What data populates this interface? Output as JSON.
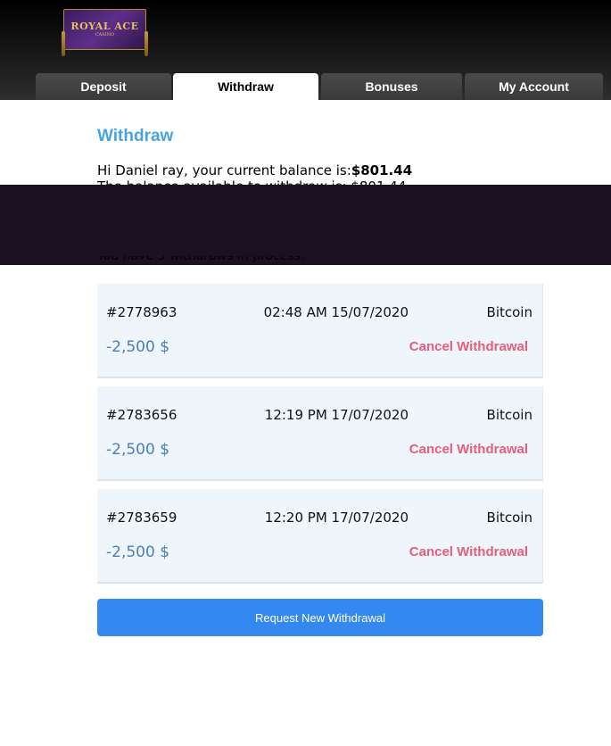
{
  "brand": {
    "logo_text": "ROYAL ACE",
    "logo_sub": "CASINO"
  },
  "tabs": [
    {
      "label": "Deposit",
      "active": false
    },
    {
      "label": "Withdraw",
      "active": true
    },
    {
      "label": "Bonuses",
      "active": false
    },
    {
      "label": "My Account",
      "active": false
    }
  ],
  "page": {
    "title": "Withdraw",
    "balance_prefix": "Hi Daniel ray, your current balance is:",
    "balance_value": "$801.44",
    "partial_line": "The balance available to withdraw is: $801.44",
    "partial_line2": "You have 3 withdraws in process:"
  },
  "withdrawals": [
    {
      "id": "#2778963",
      "datetime": "02:48 AM 15/07/2020",
      "method": "Bitcoin",
      "amount": "-2,500 $",
      "cancel_label": "Cancel Withdrawal"
    },
    {
      "id": "#2783656",
      "datetime": "12:19 PM 17/07/2020",
      "method": "Bitcoin",
      "amount": "-2,500 $",
      "cancel_label": "Cancel Withdrawal"
    },
    {
      "id": "#2783659",
      "datetime": "12:20 PM 17/07/2020",
      "method": "Bitcoin",
      "amount": "-2,500 $",
      "cancel_label": "Cancel Withdrawal"
    }
  ],
  "actions": {
    "request_label": "Request New Withdrawal"
  },
  "colors": {
    "accent": "#3488f0",
    "title": "#4aa3e0",
    "cancel": "#e85d79",
    "amount": "#4a7fb5",
    "card_bg": "#eef6fc"
  }
}
